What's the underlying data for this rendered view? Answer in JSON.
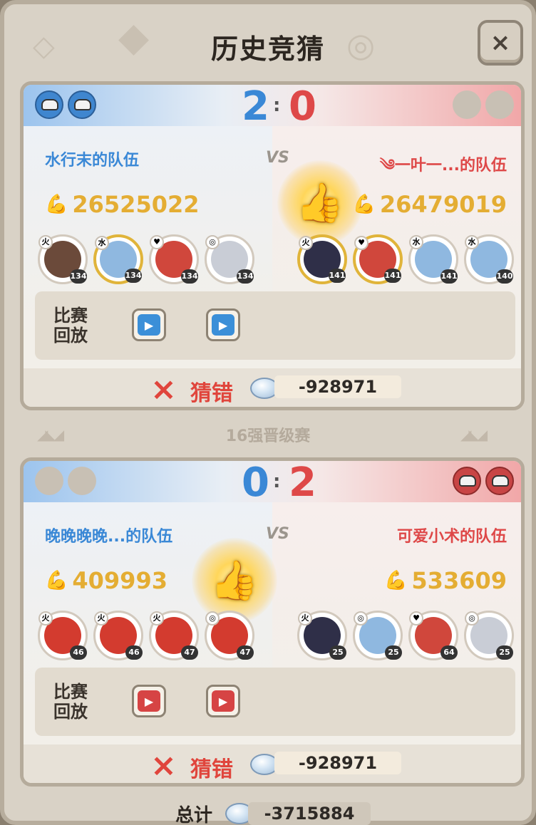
{
  "header": {
    "title": "历史竞猜",
    "close_icon": "×"
  },
  "matches": [
    {
      "score_left": "2",
      "score_right": "0",
      "colon": ":",
      "left_team": "水行末的队伍",
      "right_team": "༄一叶一...的队伍",
      "vs": "VS",
      "left_power": "26525022",
      "right_power": "26479019",
      "winner": "left",
      "left_heroes": [
        {
          "level": "134",
          "element": "火",
          "face": "#6b4a3a",
          "frame": "normal"
        },
        {
          "level": "134",
          "element": "水",
          "face": "#8fb8e0",
          "frame": "gold"
        },
        {
          "level": "134",
          "element": "♥",
          "face": "#d0473c",
          "frame": "normal"
        },
        {
          "level": "134",
          "element": "◎",
          "face": "#c9cdd6",
          "frame": "normal"
        }
      ],
      "right_heroes": [
        {
          "level": "141",
          "element": "火",
          "face": "#2f2f48",
          "frame": "gold"
        },
        {
          "level": "141",
          "element": "♥",
          "face": "#d0473c",
          "frame": "gold"
        },
        {
          "level": "141",
          "element": "水",
          "face": "#8fb8e0",
          "frame": "normal"
        },
        {
          "level": "140",
          "element": "水",
          "face": "#8fb8e0",
          "frame": "normal"
        }
      ],
      "replay_label": "比赛回放",
      "result_text": "猜错",
      "result_icon": "×",
      "amount": "-928971"
    },
    {
      "score_left": "0",
      "score_right": "2",
      "colon": ":",
      "left_team": "晚晚晚晚...的队伍",
      "right_team": "可爱小术的队伍",
      "vs": "VS",
      "left_power": "409993",
      "right_power": "533609",
      "winner": "right",
      "left_heroes": [
        {
          "level": "46",
          "element": "火",
          "face": "#d33b2f",
          "frame": "normal"
        },
        {
          "level": "46",
          "element": "火",
          "face": "#d33b2f",
          "frame": "normal"
        },
        {
          "level": "47",
          "element": "火",
          "face": "#d33b2f",
          "frame": "normal"
        },
        {
          "level": "47",
          "element": "◎",
          "face": "#d33b2f",
          "frame": "normal"
        }
      ],
      "right_heroes": [
        {
          "level": "25",
          "element": "火",
          "face": "#2f2f48",
          "frame": "normal"
        },
        {
          "level": "25",
          "element": "◎",
          "face": "#8fb8e0",
          "frame": "normal"
        },
        {
          "level": "64",
          "element": "♥",
          "face": "#d0473c",
          "frame": "normal"
        },
        {
          "level": "25",
          "element": "◎",
          "face": "#c9cdd6",
          "frame": "normal"
        }
      ],
      "replay_label": "比赛回放",
      "result_text": "猜错",
      "result_icon": "×",
      "amount": "-928971"
    }
  ],
  "divider": {
    "label": "16强晋级赛"
  },
  "total": {
    "label": "总计",
    "amount": "-3715884"
  },
  "icons": {
    "thumb": "👍",
    "arm": "💪",
    "play": "▶",
    "gem": "gem-icon"
  },
  "colors": {
    "blue_team": "#3a88d6",
    "red_team": "#de4848",
    "power_gold": "#e4ad33",
    "wrong_red": "#e0453c"
  }
}
